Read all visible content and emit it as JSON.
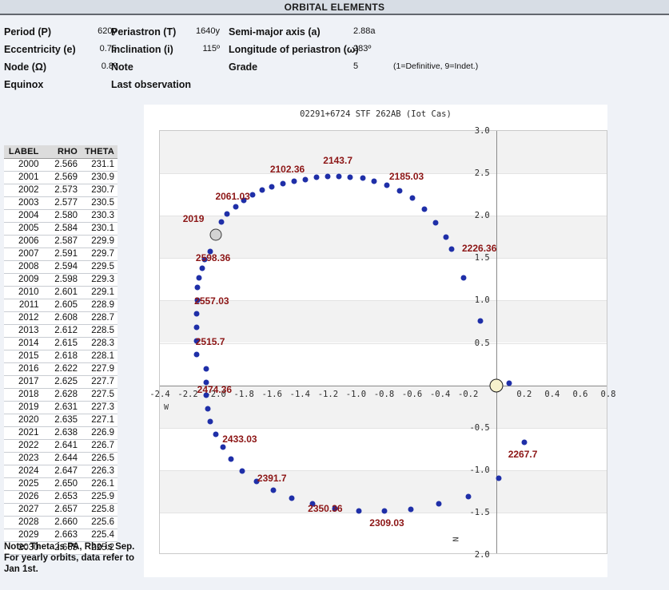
{
  "header": {
    "title": "ORBITAL ELEMENTS"
  },
  "elements": {
    "rows": [
      {
        "c1label": "Period (P)",
        "c1value": "620y",
        "c2label": "Periastron (T)",
        "c2value": "1640y",
        "c3label": "Semi-major axis (a)",
        "c3value": "2.88a",
        "c4value": ""
      },
      {
        "c1label": "Eccentricity (e)",
        "c1value": "0.75",
        "c2label": "Inclination (i)",
        "c2value": "115º",
        "c3label": "Longitude of periastron (ω)",
        "c3value": "283º",
        "c4value": ""
      },
      {
        "c1label": "Node (Ω)",
        "c1value": "0.8º",
        "c2label": "Note",
        "c2value": "",
        "c3label": "Grade",
        "c3value": "5",
        "c4value": "(1=Definitive, 9=Indet.)"
      },
      {
        "c1label": "Equinox",
        "c1value": "",
        "c2label": "Last observation",
        "c2value": "",
        "c3label": "",
        "c3value": "",
        "c4value": ""
      }
    ]
  },
  "table": {
    "headers": [
      "LABEL",
      "RHO",
      "THETA"
    ],
    "rows": [
      [
        "2000",
        "2.566",
        "231.1"
      ],
      [
        "2001",
        "2.569",
        "230.9"
      ],
      [
        "2002",
        "2.573",
        "230.7"
      ],
      [
        "2003",
        "2.577",
        "230.5"
      ],
      [
        "2004",
        "2.580",
        "230.3"
      ],
      [
        "2005",
        "2.584",
        "230.1"
      ],
      [
        "2006",
        "2.587",
        "229.9"
      ],
      [
        "2007",
        "2.591",
        "229.7"
      ],
      [
        "2008",
        "2.594",
        "229.5"
      ],
      [
        "2009",
        "2.598",
        "229.3"
      ],
      [
        "2010",
        "2.601",
        "229.1"
      ],
      [
        "2011",
        "2.605",
        "228.9"
      ],
      [
        "2012",
        "2.608",
        "228.7"
      ],
      [
        "2013",
        "2.612",
        "228.5"
      ],
      [
        "2014",
        "2.615",
        "228.3"
      ],
      [
        "2015",
        "2.618",
        "228.1"
      ],
      [
        "2016",
        "2.622",
        "227.9"
      ],
      [
        "2017",
        "2.625",
        "227.7"
      ],
      [
        "2018",
        "2.628",
        "227.5"
      ],
      [
        "2019",
        "2.631",
        "227.3"
      ],
      [
        "2020",
        "2.635",
        "227.1"
      ],
      [
        "2021",
        "2.638",
        "226.9"
      ],
      [
        "2022",
        "2.641",
        "226.7"
      ],
      [
        "2023",
        "2.644",
        "226.5"
      ],
      [
        "2024",
        "2.647",
        "226.3"
      ],
      [
        "2025",
        "2.650",
        "226.1"
      ],
      [
        "2026",
        "2.653",
        "225.9"
      ],
      [
        "2027",
        "2.657",
        "225.8"
      ],
      [
        "2028",
        "2.660",
        "225.6"
      ],
      [
        "2029",
        "2.663",
        "225.4"
      ],
      [
        "2030",
        "2.665",
        "225.2"
      ]
    ],
    "note": "Note: Theta is PA, Rho is Sep. For yearly orbits, data refer to Jan 1st."
  },
  "chart_data": {
    "type": "scatter",
    "title": "02291+6724 STF 262AB (Iot Cas)",
    "xlabel": "",
    "ylabel": "",
    "xlim": [
      -2.4,
      0.8
    ],
    "ylim": [
      -2.0,
      3.0
    ],
    "xticks": [
      "-2.4",
      "-2.2",
      "-2.0",
      "-1.8",
      "-1.6",
      "-1.4",
      "-1.2",
      "-1.0",
      "-0.8",
      "-0.6",
      "-0.4",
      "-0.2",
      "0.2",
      "0.4",
      "0.6",
      "0.8"
    ],
    "xtickvals": [
      -2.4,
      -2.2,
      -2.0,
      -1.8,
      -1.6,
      -1.4,
      -1.2,
      -1.0,
      -0.8,
      -0.6,
      -0.4,
      -0.2,
      0.2,
      0.4,
      0.6,
      0.8
    ],
    "yticks": [
      "3.0",
      "2.5",
      "2.0",
      "1.5",
      "1.0",
      "0.5",
      "-0.5",
      "-1.0",
      "-1.5",
      "2.0"
    ],
    "ytickvals": [
      3.0,
      2.5,
      2.0,
      1.5,
      1.0,
      0.5,
      -0.5,
      -1.0,
      -1.5,
      -2.0
    ],
    "grid": true,
    "direction_markers": {
      "west": "W",
      "north": "N"
    },
    "primary_star": {
      "x": 0.0,
      "y": 0.0,
      "color": "#f7f2cd"
    },
    "current_position": {
      "x": -2.0,
      "y": 1.78,
      "label": "2019",
      "color": "#d3d3d3"
    },
    "point_color": "#1f2fa8",
    "label_color": "#8c1515",
    "points": [
      {
        "x": -2.04,
        "y": 1.58
      },
      {
        "x": -2.0,
        "y": 1.78
      },
      {
        "x": -1.96,
        "y": 1.93
      },
      {
        "x": -1.92,
        "y": 2.02
      },
      {
        "x": -1.86,
        "y": 2.11
      },
      {
        "x": -1.8,
        "y": 2.18
      },
      {
        "x": -1.74,
        "y": 2.25
      },
      {
        "x": -1.67,
        "y": 2.3
      },
      {
        "x": -1.6,
        "y": 2.34
      },
      {
        "x": -1.52,
        "y": 2.38
      },
      {
        "x": -1.44,
        "y": 2.41
      },
      {
        "x": -1.36,
        "y": 2.43
      },
      {
        "x": -1.28,
        "y": 2.45
      },
      {
        "x": -1.2,
        "y": 2.46
      },
      {
        "x": -1.12,
        "y": 2.46
      },
      {
        "x": -1.04,
        "y": 2.45
      },
      {
        "x": -0.95,
        "y": 2.44
      },
      {
        "x": -0.87,
        "y": 2.41
      },
      {
        "x": -0.78,
        "y": 2.36
      },
      {
        "x": -0.69,
        "y": 2.29
      },
      {
        "x": -0.6,
        "y": 2.21
      },
      {
        "x": -0.51,
        "y": 2.08
      },
      {
        "x": -0.43,
        "y": 1.92
      },
      {
        "x": -0.36,
        "y": 1.75
      },
      {
        "x": -0.32,
        "y": 1.61
      },
      {
        "x": -0.23,
        "y": 1.27
      },
      {
        "x": -0.11,
        "y": 0.76
      },
      {
        "x": 0.09,
        "y": 0.02
      },
      {
        "x": 0.2,
        "y": -0.67
      },
      {
        "x": 0.02,
        "y": -1.1
      },
      {
        "x": -0.2,
        "y": -1.31
      },
      {
        "x": -0.41,
        "y": -1.4
      },
      {
        "x": -0.61,
        "y": -1.46
      },
      {
        "x": -0.8,
        "y": -1.48
      },
      {
        "x": -0.98,
        "y": -1.48
      },
      {
        "x": -1.15,
        "y": -1.45
      },
      {
        "x": -1.31,
        "y": -1.4
      },
      {
        "x": -1.46,
        "y": -1.33
      },
      {
        "x": -1.59,
        "y": -1.24
      },
      {
        "x": -1.71,
        "y": -1.13
      },
      {
        "x": -1.81,
        "y": -1.01
      },
      {
        "x": -1.89,
        "y": -0.87
      },
      {
        "x": -1.95,
        "y": -0.73
      },
      {
        "x": -2.0,
        "y": -0.58
      },
      {
        "x": -2.04,
        "y": -0.43
      },
      {
        "x": -2.06,
        "y": -0.28
      },
      {
        "x": -2.07,
        "y": -0.12
      },
      {
        "x": -2.07,
        "y": 0.03
      },
      {
        "x": -2.07,
        "y": 0.19
      },
      {
        "x": -2.14,
        "y": 0.36
      },
      {
        "x": -2.14,
        "y": 0.52
      },
      {
        "x": -2.14,
        "y": 0.68
      },
      {
        "x": -2.14,
        "y": 0.84
      },
      {
        "x": -2.13,
        "y": 1.0
      },
      {
        "x": -2.13,
        "y": 1.15
      },
      {
        "x": -2.12,
        "y": 1.27
      },
      {
        "x": -2.1,
        "y": 1.38
      },
      {
        "x": -2.08,
        "y": 1.48
      }
    ],
    "annotations": [
      {
        "text": "2019",
        "x": -2.16,
        "y": 1.96
      },
      {
        "text": "2061.03",
        "x": -1.88,
        "y": 2.23
      },
      {
        "text": "2102.36",
        "x": -1.49,
        "y": 2.55
      },
      {
        "text": "2143.7",
        "x": -1.13,
        "y": 2.65
      },
      {
        "text": "2185.03",
        "x": -0.64,
        "y": 2.46
      },
      {
        "text": "2226.36",
        "x": -0.12,
        "y": 1.62
      },
      {
        "text": "2267.7",
        "x": 0.19,
        "y": -0.81
      },
      {
        "text": "2309.03",
        "x": -0.78,
        "y": -1.62
      },
      {
        "text": "2350.36",
        "x": -1.22,
        "y": -1.45
      },
      {
        "text": "2391.7",
        "x": -1.6,
        "y": -1.1
      },
      {
        "text": "2433.03",
        "x": -1.83,
        "y": -0.63
      },
      {
        "text": "2474.36",
        "x": -2.01,
        "y": -0.05
      },
      {
        "text": "2515.7",
        "x": -2.04,
        "y": 0.51
      },
      {
        "text": "2557.03",
        "x": -2.03,
        "y": 0.99
      },
      {
        "text": "2598.36",
        "x": -2.02,
        "y": 1.5
      }
    ]
  }
}
